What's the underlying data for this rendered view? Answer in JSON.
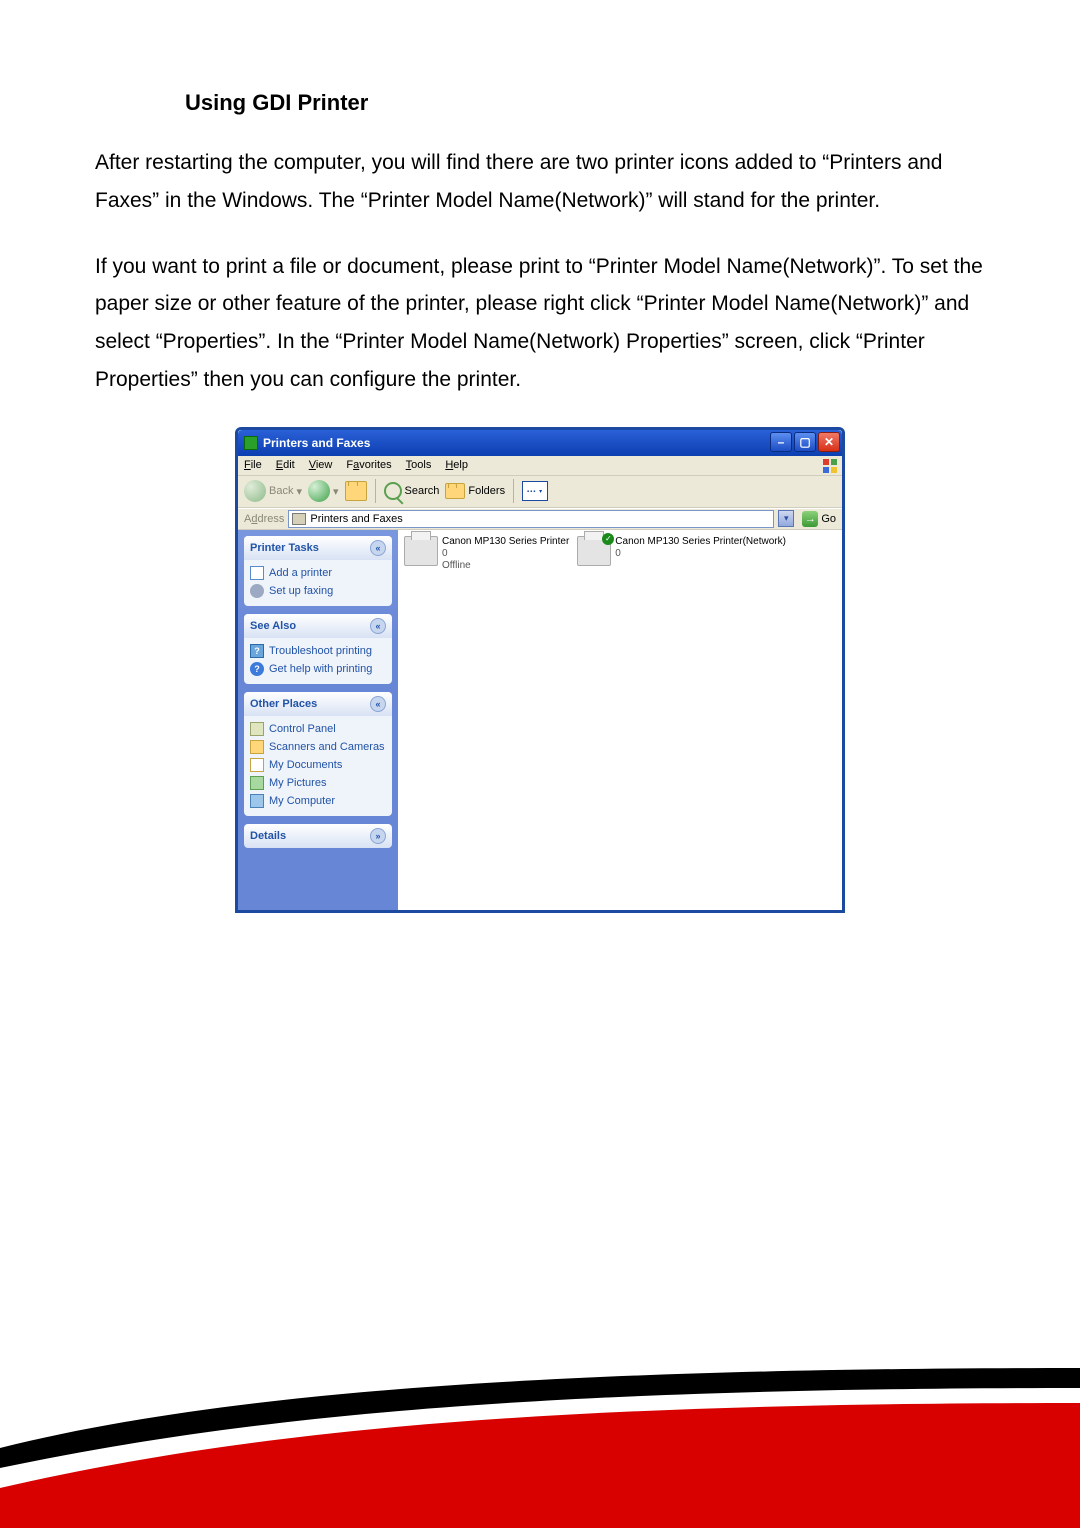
{
  "doc": {
    "heading": "Using GDI Printer",
    "para1": "After restarting the computer, you will find there are two printer icons added to “Printers and Faxes” in the Windows. The “Printer Model Name(Network)” will stand for the printer.",
    "para2": "If you want to print a file or document, please print to “Printer Model Name(Network)”. To set the paper size or other feature of the printer, please right click “Printer Model Name(Network)” and select “Properties”. In the “Printer Model Name(Network) Properties” screen, click “Printer Properties” then you can configure the printer."
  },
  "win": {
    "title": "Printers and Faxes",
    "menus": {
      "file": "File",
      "edit": "Edit",
      "view": "View",
      "favorites": "Favorites",
      "tools": "Tools",
      "help": "Help"
    },
    "toolbar": {
      "back": "Back",
      "search": "Search",
      "folders": "Folders"
    },
    "address": {
      "label": "Address",
      "value": "Printers and Faxes",
      "go": "Go"
    },
    "side": {
      "tasks": {
        "title": "Printer Tasks",
        "items": [
          "Add a printer",
          "Set up faxing"
        ]
      },
      "seealso": {
        "title": "See Also",
        "items": [
          "Troubleshoot printing",
          "Get help with printing"
        ]
      },
      "places": {
        "title": "Other Places",
        "items": [
          "Control Panel",
          "Scanners and Cameras",
          "My Documents",
          "My Pictures",
          "My Computer"
        ]
      },
      "details": {
        "title": "Details"
      }
    },
    "printers": [
      {
        "name": "Canon MP130 Series Printer",
        "line2": "0",
        "line3": "Offline",
        "check": false
      },
      {
        "name": "Canon MP130 Series Printer(Network)",
        "line2": "0",
        "line3": "",
        "check": true
      }
    ]
  }
}
